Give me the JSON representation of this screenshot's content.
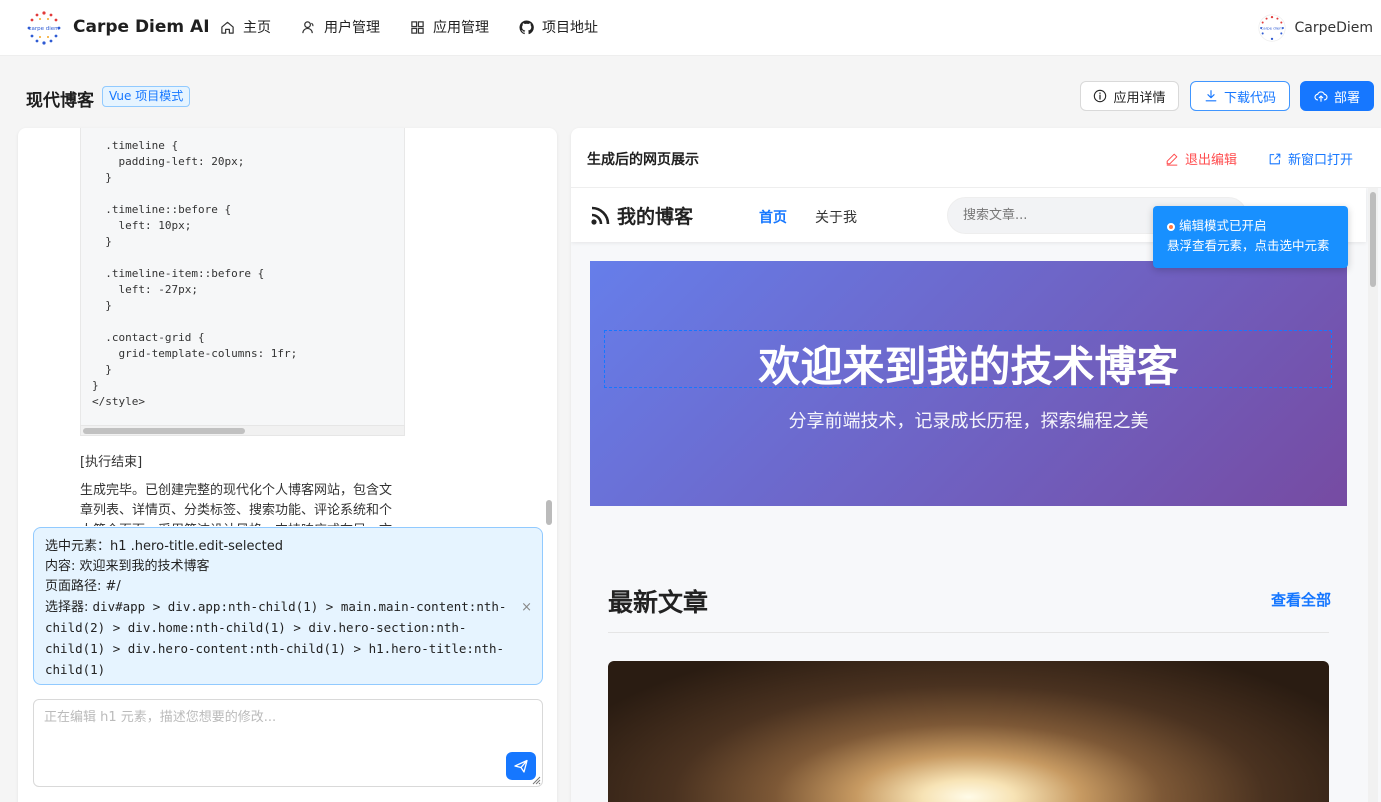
{
  "nav": {
    "brand": "Carpe Diem AI",
    "logo_text": "carpe diem",
    "items": [
      {
        "label": "主页",
        "icon": "home-icon"
      },
      {
        "label": "用户管理",
        "icon": "users-icon"
      },
      {
        "label": "应用管理",
        "icon": "apps-icon"
      },
      {
        "label": "项目地址",
        "icon": "github-icon"
      }
    ],
    "username": "CarpeDiem"
  },
  "header": {
    "title": "现代博客",
    "badge": "Vue 项目模式",
    "detail_label": "应用详情",
    "download_label": "下载代码",
    "deploy_label": "部署"
  },
  "chat": {
    "code": "  .timeline {\n    padding-left: 20px;\n  }\n\n  .timeline::before {\n    left: 10px;\n  }\n\n  .timeline-item::before {\n    left: -27px;\n  }\n\n  .contact-grid {\n    grid-template-columns: 1fr;\n  }\n}\n</style>",
    "exec_end": "[执行结束]",
    "summary": "生成完毕。已创建完整的现代化个人博客网站，包含文章列表、详情页、分类标签、搜索功能、评论系统和个人简介页面，采用简洁设计风格，支持响应式布局，文章支持",
    "selected": {
      "element": "选中元素：h1 .hero-title.edit-selected",
      "content": "内容: 欢迎来到我的技术博客",
      "path": "页面路径: #/",
      "selector_label": "选择器: ",
      "selector": "div#app > div.app:nth-child(1) > main.main-content:nth-child(2) > div.home:nth-child(1) > div.hero-section:nth-child(1) > div.hero-content:nth-child(1) > h1.hero-title:nth-child(1)",
      "close": "×"
    },
    "input_placeholder": "正在编辑 h1 元素，描述您想要的修改..."
  },
  "preview": {
    "title": "生成后的网页展示",
    "exit_edit": "退出编辑",
    "open_new": "新窗口打开",
    "blog": {
      "logo": "我的博客",
      "home": "首页",
      "about": "关于我",
      "search_placeholder": "搜索文章...",
      "hero_title": "欢迎来到我的技术博客",
      "hero_sub": "分享前端技术，记录成长历程，探索编程之美",
      "latest": "最新文章",
      "view_all": "查看全部"
    },
    "toast": {
      "line1": "编辑模式已开启",
      "line2": "悬浮查看元素，点击选中元素"
    }
  },
  "colors": {
    "primary": "#1677ff",
    "danger": "#ff4d4f",
    "hero_gradient_start": "#667eea",
    "hero_gradient_end": "#764ba2"
  }
}
